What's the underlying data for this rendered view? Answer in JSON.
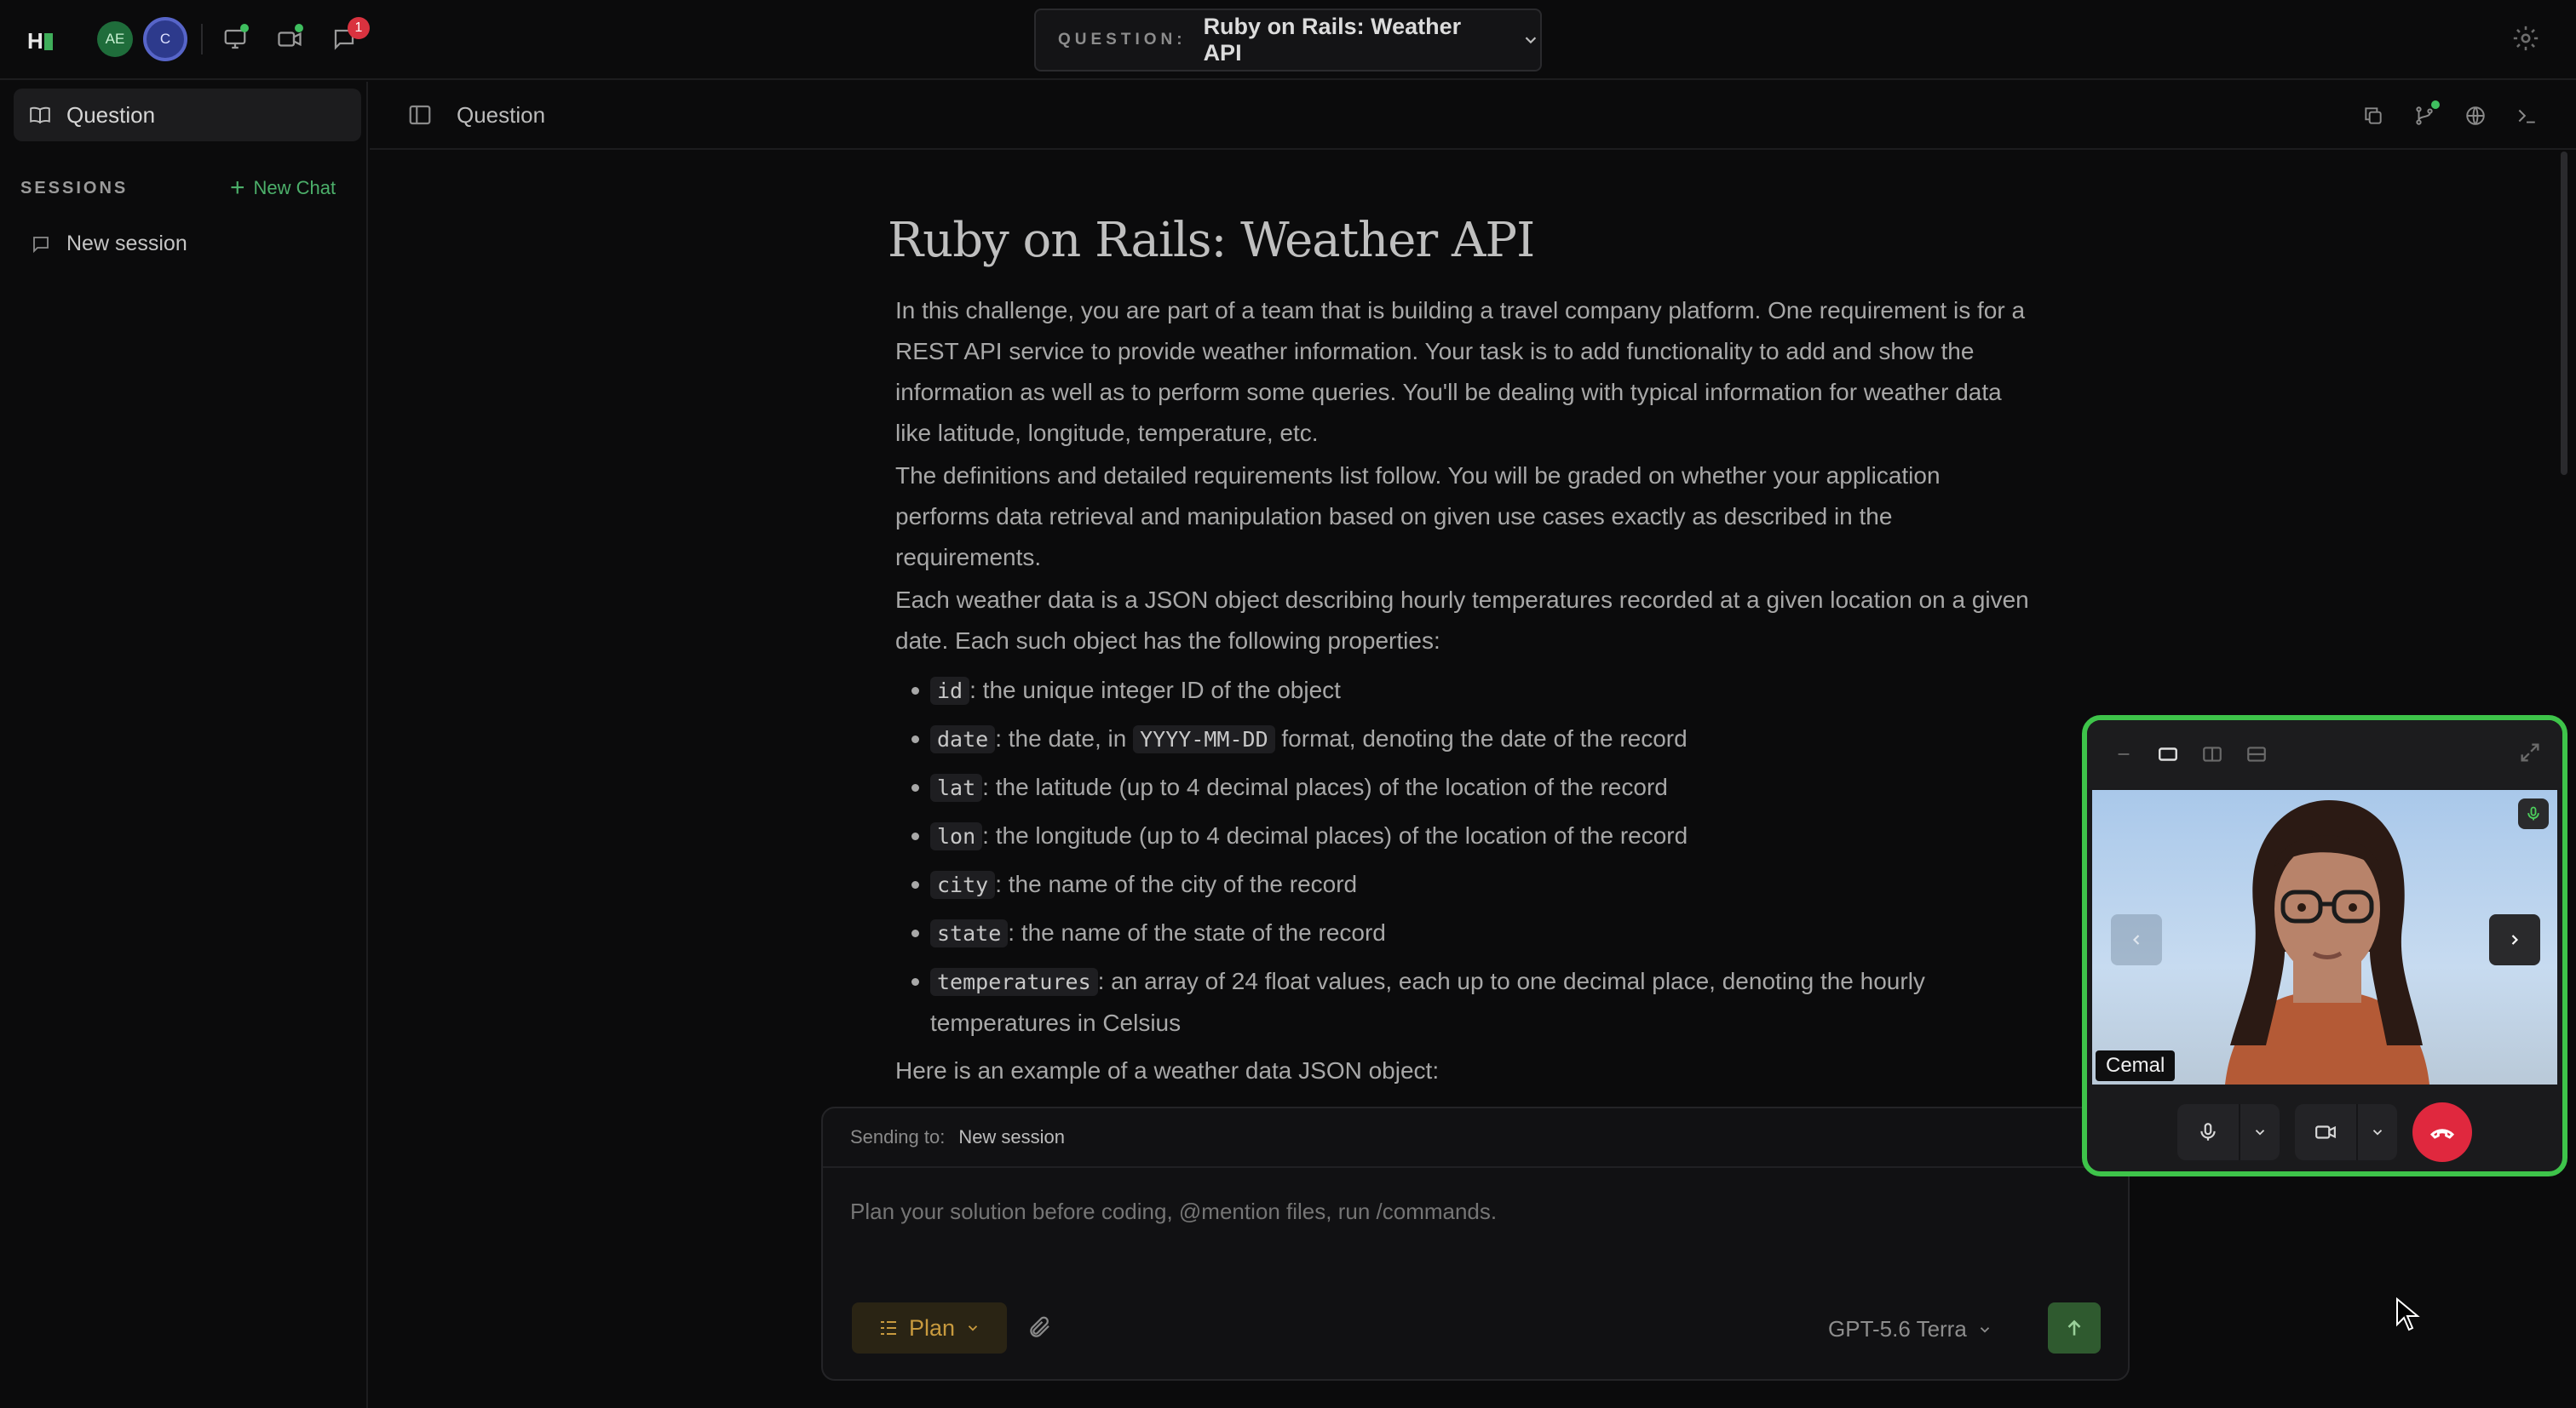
{
  "topbar": {
    "logo": "H",
    "avatars": [
      "AE",
      "C"
    ],
    "notifications_count": "1",
    "question_label": "QUESTION:",
    "question_title": "Ruby on Rails: Weather API"
  },
  "sidebar": {
    "question_item": "Question",
    "sessions_heading": "SESSIONS",
    "new_chat": "New Chat",
    "sessions": [
      "New session"
    ]
  },
  "tabbar": {
    "title": "Question"
  },
  "document": {
    "title": "Ruby on Rails: Weather API",
    "paragraphs": [
      "In this challenge, you are part of a team that is building a travel company platform. One requirement is for a REST API service to provide weather information. Your task is to add functionality to add and show the information as well as to perform some queries. You'll be dealing with typical information for weather data like latitude, longitude, temperature, etc.",
      "The definitions and detailed requirements list follow. You will be graded on whether your application performs data retrieval and manipulation based on given use cases exactly as described in the requirements.",
      "Each weather data is a JSON object describing hourly temperatures recorded at a given location on a given date. Each such object has the following properties:"
    ],
    "properties": [
      {
        "code": "id",
        "text": ": the unique integer ID of the object"
      },
      {
        "code": "date",
        "text_a": ": the date, in ",
        "code2": "YYYY-MM-DD",
        "text_b": " format, denoting the date of the record"
      },
      {
        "code": "lat",
        "text": ": the latitude (up to 4 decimal places) of the location of the record"
      },
      {
        "code": "lon",
        "text": ": the longitude (up to 4 decimal places) of the location of the record"
      },
      {
        "code": "city",
        "text": ": the name of the city of the record"
      },
      {
        "code": "state",
        "text": ": the name of the state of the record"
      },
      {
        "code": "temperatures",
        "text": ": an array of 24 float values, each up to one decimal place, denoting the hourly temperatures in Celsius"
      }
    ],
    "closing": "Here is an example of a weather data JSON object:"
  },
  "composer": {
    "sending_to_label": "Sending to:",
    "sending_to_value": "New session",
    "placeholder": "Plan your solution before coding, @mention files, run /commands.",
    "mode": "Plan",
    "model": "GPT-5.6 Terra"
  },
  "call": {
    "participant_name": "Cemal"
  },
  "colors": {
    "accent_green": "#3ec44a",
    "hangup_red": "#e0283e",
    "plan_amber": "#c89a3e"
  }
}
